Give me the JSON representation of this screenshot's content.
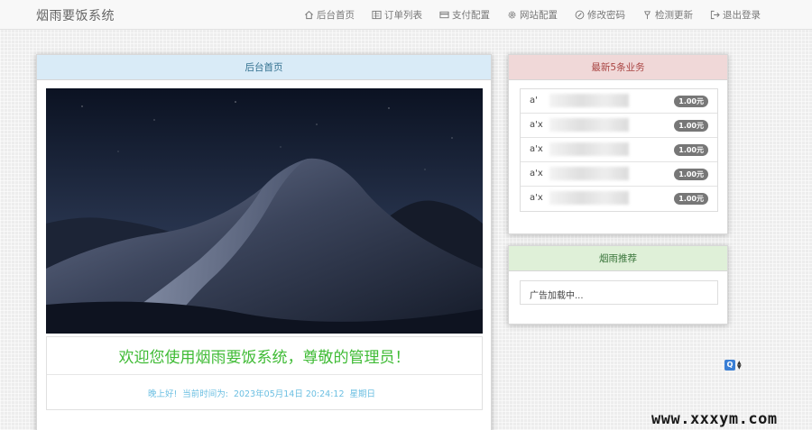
{
  "brand": "烟雨要饭系统",
  "nav": [
    {
      "label": "后台首页",
      "icon": "home-icon"
    },
    {
      "label": "订单列表",
      "icon": "list-icon"
    },
    {
      "label": "支付配置",
      "icon": "card-icon"
    },
    {
      "label": "网站配置",
      "icon": "gear-icon"
    },
    {
      "label": "修改密码",
      "icon": "edit-icon"
    },
    {
      "label": "检测更新",
      "icon": "pin-icon"
    },
    {
      "label": "退出登录",
      "icon": "logout-icon"
    }
  ],
  "main": {
    "title": "后台首页",
    "welcome": "欢迎您使用烟雨要饭系统，尊敬的管理员！",
    "greeting": "晚上好!",
    "time_label": "当前时间为:",
    "time_value": "2023年05月14日 20:24:12",
    "weekday": "星期日"
  },
  "latest": {
    "title": "最新5条业务",
    "orders": [
      {
        "name": "a'",
        "price": "1.00元"
      },
      {
        "name": "a'x",
        "price": "1.00元"
      },
      {
        "name": "a'x",
        "price": "1.00元"
      },
      {
        "name": "a'x",
        "price": "1.00元"
      },
      {
        "name": "a'x",
        "price": "1.00元"
      }
    ]
  },
  "recommend": {
    "title": "烟雨推荐",
    "text": "广告加载中..."
  },
  "watermark": "www.xxxym.com",
  "colors": {
    "welcome_green": "#3fbb35",
    "time_blue": "#6bbfe2",
    "main_header": "#d9ebf7",
    "latest_header": "#f0d8d8",
    "recommend_header": "#dff0d8"
  }
}
